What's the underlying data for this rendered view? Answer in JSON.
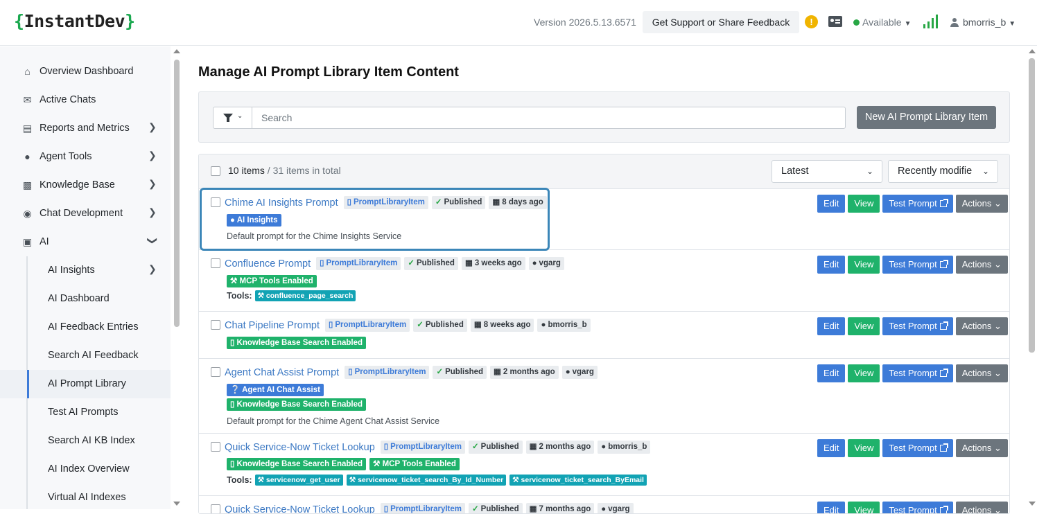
{
  "header": {
    "logo_open": "{",
    "logo_text": "InstantDev",
    "logo_close": "}",
    "version": "Version 2026.5.13.6571",
    "support_label": "Get Support or Share Feedback",
    "status": "Available",
    "username": "bmorris_b",
    "brand_color": "#1aa84f"
  },
  "sidebar": {
    "items": [
      {
        "label": "Overview Dashboard",
        "icon": "home-icon"
      },
      {
        "label": "Active Chats",
        "icon": "chats-icon"
      },
      {
        "label": "Reports and Metrics",
        "icon": "chart-icon"
      },
      {
        "label": "Agent Tools",
        "icon": "users-icon"
      },
      {
        "label": "Knowledge Base",
        "icon": "book-icon"
      },
      {
        "label": "Chat Development",
        "icon": "chat-bubble-icon"
      },
      {
        "label": "AI",
        "icon": "robot-icon"
      }
    ],
    "sub_items": [
      {
        "label": "AI Insights"
      },
      {
        "label": "AI Dashboard"
      },
      {
        "label": "AI Feedback Entries"
      },
      {
        "label": "Search AI Feedback"
      },
      {
        "label": "AI Prompt Library"
      },
      {
        "label": "Test AI Prompts"
      },
      {
        "label": "Search AI KB Index"
      },
      {
        "label": "AI Index Overview"
      },
      {
        "label": "Virtual AI Indexes"
      }
    ]
  },
  "main": {
    "title": "Manage AI Prompt Library Item Content",
    "search_placeholder": "Search",
    "new_button": "New AI Prompt Library Item",
    "count_items": "10 items",
    "count_total": " / 31 items in total",
    "sort_select": "Latest",
    "sort_field": "Recently modifie",
    "buttons": {
      "edit": "Edit",
      "view": "View",
      "test": "Test Prompt",
      "actions": "Actions"
    },
    "tools_label": "Tools:",
    "rows": [
      {
        "title": "Chime AI Insights Prompt",
        "type": "PromptLibraryItem",
        "state": "Published",
        "age": "8 days ago",
        "badge1": "AI Insights",
        "desc": "Default prompt for the Chime Insights Service"
      },
      {
        "title": "Confluence Prompt",
        "type": "PromptLibraryItem",
        "state": "Published",
        "age": "3 weeks ago",
        "user": "vgarg",
        "badge1": "MCP Tools Enabled",
        "tool1": "confluence_page_search"
      },
      {
        "title": "Chat Pipeline Prompt",
        "type": "PromptLibraryItem",
        "state": "Published",
        "age": "8 weeks ago",
        "user": "bmorris_b",
        "badge1": "Knowledge Base Search Enabled"
      },
      {
        "title": "Agent Chat Assist Prompt",
        "type": "PromptLibraryItem",
        "state": "Published",
        "age": "2 months ago",
        "user": "vgarg",
        "badge1": "Agent AI Chat Assist",
        "badge2": "Knowledge Base Search Enabled",
        "desc": "Default prompt for the Chime Agent Chat Assist Service"
      },
      {
        "title": "Quick Service-Now Ticket Lookup",
        "type": "PromptLibraryItem",
        "state": "Published",
        "age": "2 months ago",
        "user": "bmorris_b",
        "badge1": "Knowledge Base Search Enabled",
        "badge2": "MCP Tools Enabled",
        "tool1": "servicenow_get_user",
        "tool2": "servicenow_ticket_search_By_Id_Number",
        "tool3": "servicenow_ticket_search_ByEmail"
      },
      {
        "title": "Quick Service-Now Ticket Lookup",
        "type": "PromptLibraryItem",
        "state": "Published",
        "age": "7 months ago",
        "user": "vgarg"
      }
    ]
  }
}
